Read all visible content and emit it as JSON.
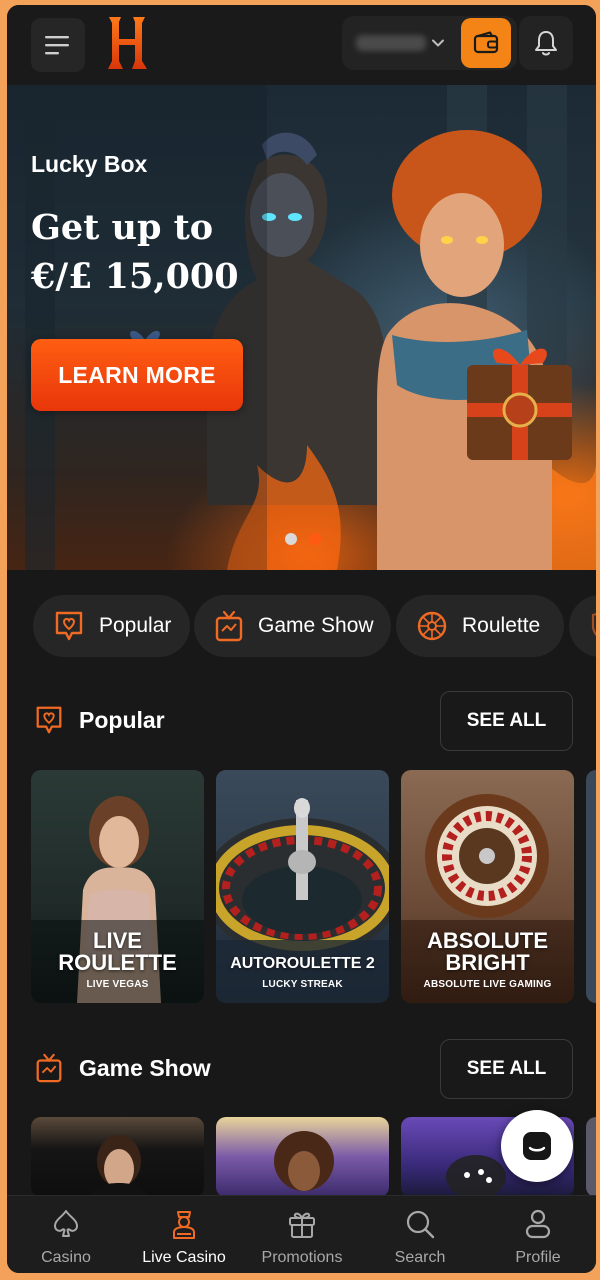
{
  "header": {
    "balance_hidden": "",
    "logo_letter": "H"
  },
  "hero": {
    "subtitle": "Lucky Box",
    "title_line1": "Get up to",
    "title_line2": "€/£ 15,000",
    "cta_label": "LEARN MORE",
    "slides_total": 2,
    "active_slide": 2
  },
  "categories": [
    {
      "label": "Popular",
      "icon": "heart-chat-icon"
    },
    {
      "label": "Game Show",
      "icon": "tv-icon"
    },
    {
      "label": "Roulette",
      "icon": "roulette-icon"
    }
  ],
  "sections": {
    "popular": {
      "title": "Popular",
      "see_all": "SEE ALL",
      "games": [
        {
          "name_line1": "LIVE",
          "name_line2": "ROULETTE",
          "provider": "LIVE VEGAS"
        },
        {
          "name_line1": "AUTOROULETTE 2",
          "name_line2": "",
          "provider": "LUCKY STREAK"
        },
        {
          "name_line1": "ABSOLUTE",
          "name_line2": "BRIGHT",
          "provider": "ABSOLUTE LIVE GAMING"
        }
      ]
    },
    "game_show": {
      "title": "Game Show",
      "see_all": "SEE ALL"
    }
  },
  "bottom_nav": [
    {
      "label": "Casino",
      "icon": "spade-icon"
    },
    {
      "label": "Live Casino",
      "icon": "dealer-icon",
      "active": true
    },
    {
      "label": "Promotions",
      "icon": "gift-icon"
    },
    {
      "label": "Search",
      "icon": "search-icon"
    },
    {
      "label": "Profile",
      "icon": "user-icon"
    }
  ],
  "colors": {
    "accent": "#f48416",
    "cta": "#ff5e12",
    "background": "#181818",
    "surface": "#262626"
  }
}
